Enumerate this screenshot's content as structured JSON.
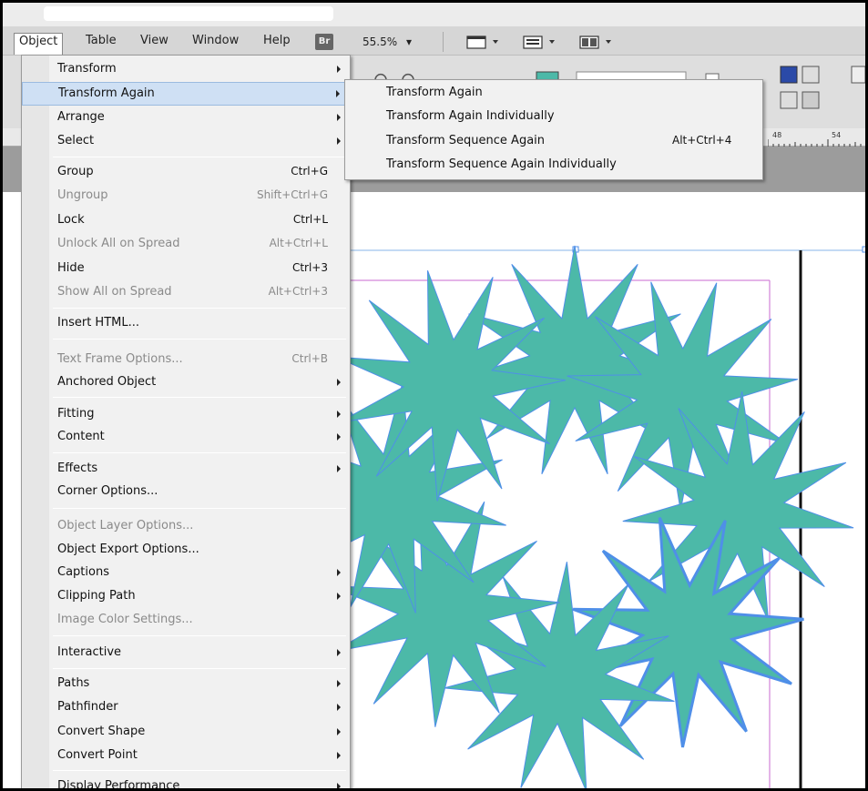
{
  "menubar": {
    "items": [
      "Object",
      "Table",
      "View",
      "Window",
      "Help"
    ],
    "bridge_badge": "Br",
    "zoom": "55.5%",
    "zoom_arrow": "▾"
  },
  "ruler": {
    "labels": [
      "48",
      "54"
    ]
  },
  "object_menu": {
    "items": [
      {
        "label": "Transform",
        "shortcut": "",
        "submenu": true,
        "disabled": false
      },
      {
        "label": "Transform Again",
        "shortcut": "",
        "submenu": true,
        "disabled": false,
        "highlighted": true
      },
      {
        "label": "Arrange",
        "shortcut": "",
        "submenu": true,
        "disabled": false
      },
      {
        "label": "Select",
        "shortcut": "",
        "submenu": true,
        "disabled": false
      },
      {
        "label": "Group",
        "shortcut": "Ctrl+G",
        "submenu": false,
        "disabled": false
      },
      {
        "label": "Ungroup",
        "shortcut": "Shift+Ctrl+G",
        "submenu": false,
        "disabled": true
      },
      {
        "label": "Lock",
        "shortcut": "Ctrl+L",
        "submenu": false,
        "disabled": false
      },
      {
        "label": "Unlock All on Spread",
        "shortcut": "Alt+Ctrl+L",
        "submenu": false,
        "disabled": true
      },
      {
        "label": "Hide",
        "shortcut": "Ctrl+3",
        "submenu": false,
        "disabled": false
      },
      {
        "label": "Show All on Spread",
        "shortcut": "Alt+Ctrl+3",
        "submenu": false,
        "disabled": true
      },
      {
        "label": "Insert HTML...",
        "shortcut": "",
        "submenu": false,
        "disabled": false
      },
      {
        "label": "Text Frame Options...",
        "shortcut": "Ctrl+B",
        "submenu": false,
        "disabled": true
      },
      {
        "label": "Anchored Object",
        "shortcut": "",
        "submenu": true,
        "disabled": false
      },
      {
        "label": "Fitting",
        "shortcut": "",
        "submenu": true,
        "disabled": false
      },
      {
        "label": "Content",
        "shortcut": "",
        "submenu": true,
        "disabled": false
      },
      {
        "label": "Effects",
        "shortcut": "",
        "submenu": true,
        "disabled": false
      },
      {
        "label": "Corner Options...",
        "shortcut": "",
        "submenu": false,
        "disabled": false
      },
      {
        "label": "Object Layer Options...",
        "shortcut": "",
        "submenu": false,
        "disabled": true
      },
      {
        "label": "Object Export Options...",
        "shortcut": "",
        "submenu": false,
        "disabled": false
      },
      {
        "label": "Captions",
        "shortcut": "",
        "submenu": true,
        "disabled": false
      },
      {
        "label": "Clipping Path",
        "shortcut": "",
        "submenu": true,
        "disabled": false
      },
      {
        "label": "Image Color Settings...",
        "shortcut": "",
        "submenu": false,
        "disabled": true
      },
      {
        "label": "Interactive",
        "shortcut": "",
        "submenu": true,
        "disabled": false
      },
      {
        "label": "Paths",
        "shortcut": "",
        "submenu": true,
        "disabled": false
      },
      {
        "label": "Pathfinder",
        "shortcut": "",
        "submenu": true,
        "disabled": false
      },
      {
        "label": "Convert Shape",
        "shortcut": "",
        "submenu": true,
        "disabled": false
      },
      {
        "label": "Convert Point",
        "shortcut": "",
        "submenu": true,
        "disabled": false
      },
      {
        "label": "Display Performance",
        "shortcut": "",
        "submenu": true,
        "disabled": false
      }
    ]
  },
  "transform_again_submenu": {
    "items": [
      {
        "label": "Transform Again",
        "shortcut": ""
      },
      {
        "label": "Transform Again Individually",
        "shortcut": ""
      },
      {
        "label": "Transform Sequence Again",
        "shortcut": "Alt+Ctrl+4"
      },
      {
        "label": "Transform Sequence Again Individually",
        "shortcut": ""
      }
    ]
  },
  "colors": {
    "star_fill": "#4cb9a8",
    "star_stroke": "#4f8fe8",
    "menu_highlight": "#cfe0f4",
    "margin_guide": "#c86ad0"
  }
}
